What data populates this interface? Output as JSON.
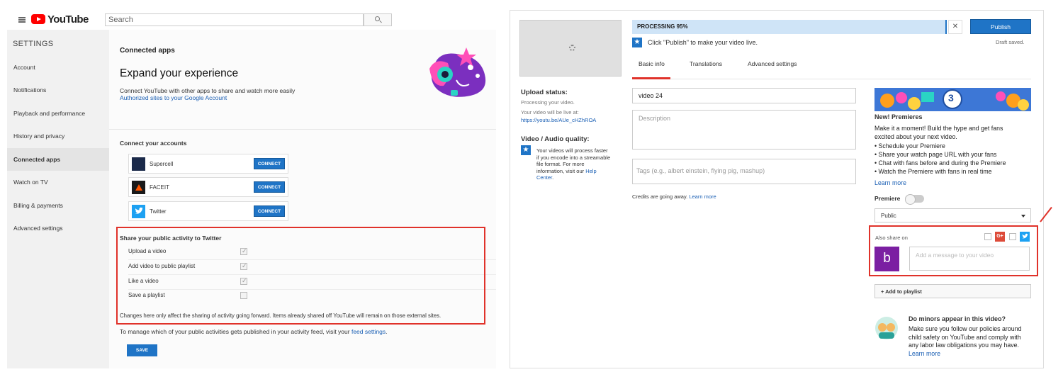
{
  "left": {
    "brand": "YouTube",
    "search_placeholder": "Search",
    "sidebar": {
      "title": "SETTINGS",
      "items": [
        {
          "label": "Account"
        },
        {
          "label": "Notifications"
        },
        {
          "label": "Playback and performance"
        },
        {
          "label": "History and privacy"
        },
        {
          "label": "Connected apps"
        },
        {
          "label": "Watch on TV"
        },
        {
          "label": "Billing & payments"
        },
        {
          "label": "Advanced settings"
        }
      ],
      "active_index": 4
    },
    "section_title": "Connected apps",
    "headline": "Expand your experience",
    "description": "Connect YouTube with other apps to share and watch more easily",
    "authorized_link": "Authorized sites to your Google Account",
    "accounts_heading": "Connect your accounts",
    "accounts": [
      {
        "name": "Supercell",
        "button": "CONNECT",
        "icon": "supercell-icon",
        "color": "#1b2a4a"
      },
      {
        "name": "FACEIT",
        "button": "CONNECT",
        "icon": "faceit-icon",
        "color": "#1a1a1a"
      },
      {
        "name": "Twitter",
        "button": "CONNECT",
        "icon": "twitter-icon",
        "color": "#1da1f2"
      }
    ],
    "share_heading": "Share your public activity to Twitter",
    "share_options": [
      {
        "label": "Upload a video",
        "checked": true
      },
      {
        "label": "Add video to public playlist",
        "checked": true
      },
      {
        "label": "Like a video",
        "checked": true
      },
      {
        "label": "Save a playlist",
        "checked": false
      }
    ],
    "share_note": "Changes here only affect the sharing of activity going forward. Items already shared off YouTube will remain on those external sites.",
    "manage_text": "To manage which of your public activities gets published in your activity feed, visit your",
    "manage_link": "feed settings",
    "manage_end": ".",
    "save_button": "SAVE"
  },
  "right": {
    "progress_label": "PROCESSING 95%",
    "progress_fraction": 0.95,
    "cancel_icon": "close-icon",
    "publish_button": "Publish",
    "draft_status": "Draft saved.",
    "hint": "Click \"Publish\" to make your video live.",
    "tabs": [
      {
        "label": "Basic info"
      },
      {
        "label": "Translations"
      },
      {
        "label": "Advanced settings"
      }
    ],
    "upload_status_label": "Upload status:",
    "upload_status_text": "Processing your video.",
    "live_at_text": "Your video will be live at:",
    "video_url": "https://youtu.be/AUe_cHZhROA",
    "quality_label": "Video / Audio quality:",
    "quality_text": "Your videos will process faster if you encode into a streamable file format. For more information, visit our",
    "help_center_link": "Help Center",
    "help_center_end": ".",
    "title_value": "video 24",
    "description_placeholder": "Description",
    "tags_placeholder": "Tags (e.g., albert einstein, flying pig, mashup)",
    "credits_text": "Credits are going away.",
    "credits_link": "Learn more",
    "premieres": {
      "badge_number": "3",
      "title": "New! Premieres",
      "intro": "Make it a moment! Build the hype and get fans excited about your next video.",
      "bullets": [
        "• Schedule your Premiere",
        "• Share your watch page URL with your fans",
        "• Chat with fans before and during the Premiere",
        "• Watch the Premiere with fans in real time"
      ],
      "learn_more": "Learn more"
    },
    "premiere_toggle_label": "Premiere",
    "visibility_value": "Public",
    "also_share_label": "Also share on",
    "gplus_label": "G+",
    "avatar_letter": "b",
    "message_placeholder": "Add a message to your video",
    "add_playlist": "+ Add to playlist",
    "minors_heading": "Do minors appear in this video?",
    "minors_text": "Make sure you follow our policies around child safety on YouTube and comply with any labor law obligations you may have.",
    "minors_link": "Learn more",
    "accent_color": "#1f74c6",
    "highlight_color": "#e0322a"
  }
}
